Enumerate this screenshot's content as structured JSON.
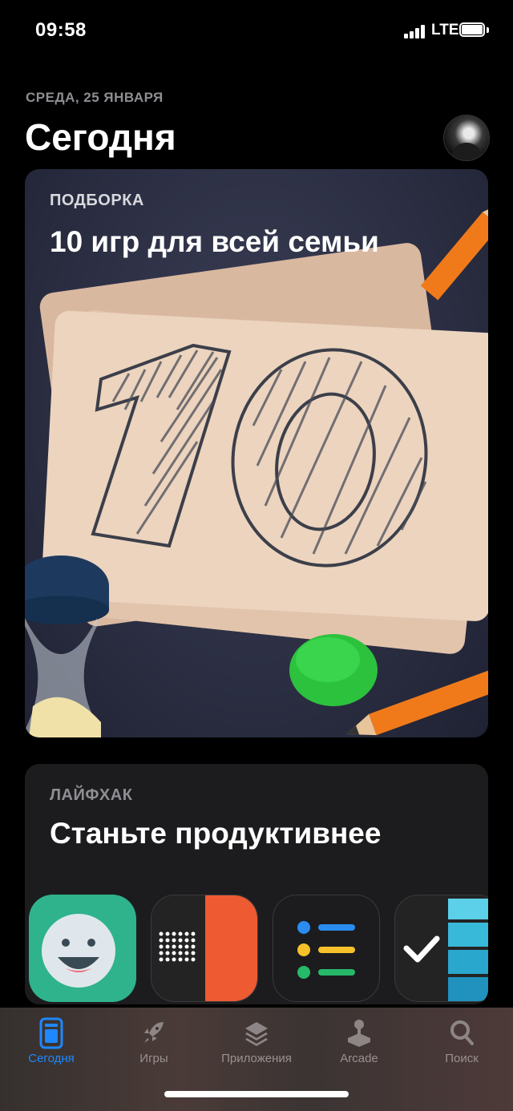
{
  "status_bar": {
    "time": "09:58",
    "network": "LTE"
  },
  "header": {
    "date": "СРЕДА, 25 ЯНВАРЯ",
    "title": "Сегодня"
  },
  "cards": [
    {
      "eyebrow": "ПОДБОРКА",
      "title": "10 игр для всей семьи",
      "artwork_number": "10"
    },
    {
      "eyebrow": "ЛАЙФХАК",
      "title": "Станьте продуктивнее"
    }
  ],
  "tabs": [
    {
      "label": "Сегодня",
      "icon": "today-icon",
      "active": true
    },
    {
      "label": "Игры",
      "icon": "rocket-icon",
      "active": false
    },
    {
      "label": "Приложения",
      "icon": "layers-icon",
      "active": false
    },
    {
      "label": "Arcade",
      "icon": "joystick-icon",
      "active": false
    },
    {
      "label": "Поиск",
      "icon": "search-icon",
      "active": false
    }
  ],
  "colors": {
    "accent": "#1e88ff",
    "card_bg": "#1c1c1e"
  }
}
